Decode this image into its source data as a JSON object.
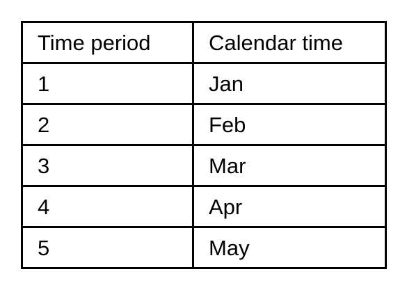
{
  "table": {
    "headers": [
      "Time period",
      "Calendar time"
    ],
    "rows": [
      [
        "1",
        "Jan"
      ],
      [
        "2",
        "Feb"
      ],
      [
        "3",
        "Mar"
      ],
      [
        "4",
        "Apr"
      ],
      [
        "5",
        "May"
      ]
    ]
  }
}
